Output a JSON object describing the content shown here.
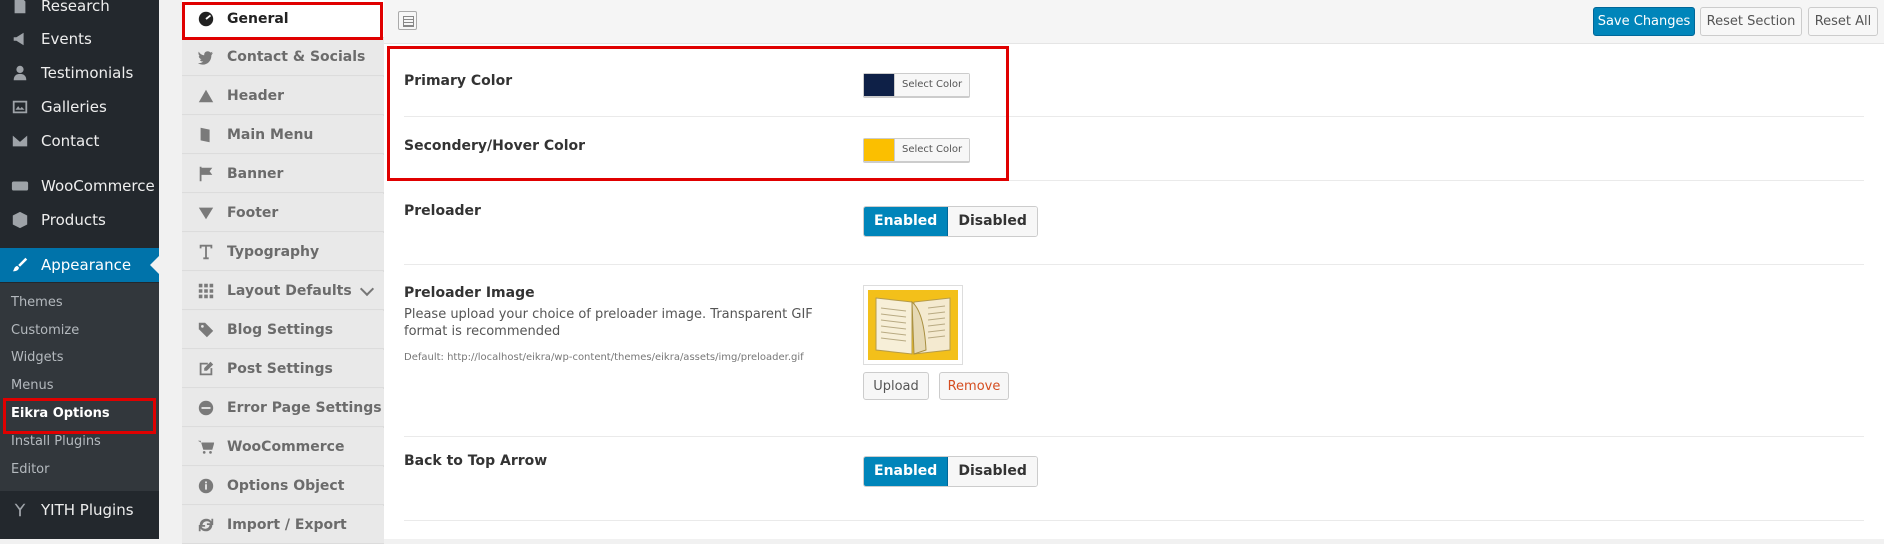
{
  "admin_menu": {
    "items": [
      {
        "label": "Research",
        "icon": "page-icon"
      },
      {
        "label": "Events",
        "icon": "megaphone-icon"
      },
      {
        "label": "Testimonials",
        "icon": "person-icon"
      },
      {
        "label": "Galleries",
        "icon": "gallery-icon"
      },
      {
        "label": "Contact",
        "icon": "envelope-icon"
      },
      {
        "label": "WooCommerce",
        "icon": "woocommerce-icon"
      },
      {
        "label": "Products",
        "icon": "box-icon"
      },
      {
        "label": "Appearance",
        "icon": "paintbrush-icon",
        "current": true
      }
    ],
    "submenu": [
      "Themes",
      "Customize",
      "Widgets",
      "Menus",
      "Eikra Options",
      "Install Plugins",
      "Editor"
    ],
    "after": {
      "label": "YITH Plugins",
      "icon": "yith-icon"
    }
  },
  "options_nav": {
    "items": [
      {
        "label": "General",
        "icon": "dashboard-icon",
        "active": true
      },
      {
        "label": "Contact & Socials",
        "icon": "twitter-icon"
      },
      {
        "label": "Header",
        "icon": "triangle-up-icon"
      },
      {
        "label": "Main Menu",
        "icon": "book-icon"
      },
      {
        "label": "Banner",
        "icon": "flag-icon"
      },
      {
        "label": "Footer",
        "icon": "triangle-down-icon"
      },
      {
        "label": "Typography",
        "icon": "text-icon"
      },
      {
        "label": "Layout Defaults",
        "icon": "grid-icon"
      },
      {
        "label": "Blog Settings",
        "icon": "tags-icon"
      },
      {
        "label": "Post Settings",
        "icon": "edit-icon"
      },
      {
        "label": "Error Page Settings",
        "icon": "minus-circle-icon"
      },
      {
        "label": "WooCommerce",
        "icon": "cart-icon"
      },
      {
        "label": "Options Object",
        "icon": "info-icon"
      },
      {
        "label": "Import / Export",
        "icon": "refresh-icon"
      }
    ]
  },
  "toolbar": {
    "save_label": "Save Changes",
    "reset_section_label": "Reset Section",
    "reset_all_label": "Reset All"
  },
  "fields": {
    "primary_color": {
      "title": "Primary Color",
      "color": "#0e2047",
      "button": "Select Color"
    },
    "secondary_color": {
      "title": "Secondery/Hover Color",
      "color": "#fbbf00",
      "button": "Select Color"
    },
    "preloader": {
      "title": "Preloader",
      "on": "Enabled",
      "off": "Disabled",
      "value": "Enabled"
    },
    "preloader_image": {
      "title": "Preloader Image",
      "description": "Please upload your choice of preloader image. Transparent GIF format is recommended",
      "default_text": "Default: http://localhost/eikra/wp-content/themes/eikra/assets/img/preloader.gif",
      "upload": "Upload",
      "remove": "Remove"
    },
    "back_to_top": {
      "title": "Back to Top Arrow",
      "on": "Enabled",
      "off": "Disabled",
      "value": "Enabled"
    }
  },
  "colors": {
    "wp_dark": "#23282d",
    "wp_blue": "#0073aa",
    "button_blue": "#0085ba",
    "highlight_red": "#e00000"
  }
}
